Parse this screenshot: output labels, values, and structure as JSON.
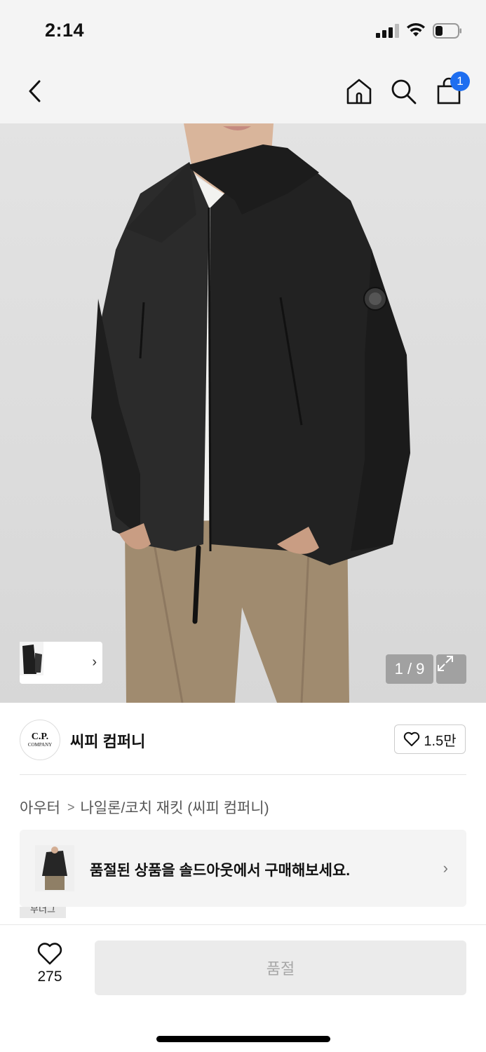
{
  "status_bar": {
    "time": "2:14"
  },
  "nav": {
    "cart_count": "1"
  },
  "gallery": {
    "page_indicator": "1 / 9",
    "current_page": 1,
    "total_pages": 9,
    "thumb_arrow": "›"
  },
  "brand": {
    "logo_line1": "C.P.",
    "logo_line2": "COMPANY",
    "name": "씨피 컴퍼니",
    "like_count": "1.5만"
  },
  "breadcrumb": {
    "category": "아우터",
    "subcategory": "나일론/코치 재킷 (씨피 컴퍼니)"
  },
  "soldout_banner": {
    "text": "품절된 상품을 솔드아웃에서 구매해보세요."
  },
  "partial_tag": "무너그",
  "bottom_bar": {
    "wish_count": "275",
    "buy_label": "품절"
  },
  "colors": {
    "accent": "#1e6ef0",
    "disabled_button": "#ebebeb",
    "disabled_text": "#a7a7a7"
  },
  "icons": [
    "back-icon",
    "home-icon",
    "search-icon",
    "cart-icon",
    "heart-icon",
    "expand-icon",
    "chevron-right-icon"
  ]
}
